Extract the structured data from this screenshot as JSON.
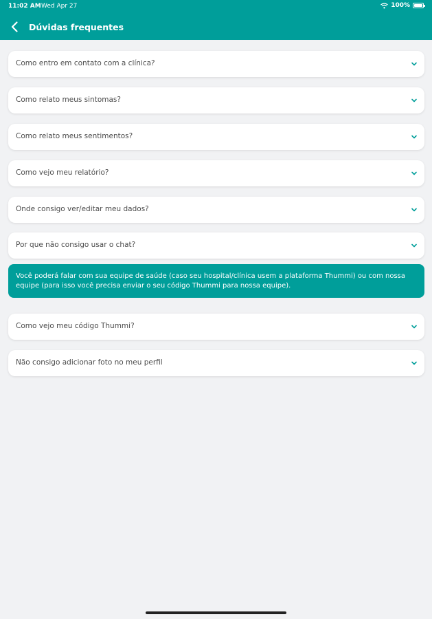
{
  "status": {
    "time": "11:02 AM",
    "date": "Wed Apr 27",
    "battery": "100%",
    "battery_level": 1.0
  },
  "header": {
    "title": "Dúvidas frequentes",
    "back_icon": "chevron-left-icon",
    "color": "#009e9a"
  },
  "faq": {
    "items": [
      {
        "question": "Como entro em contato com a clínica?"
      },
      {
        "question": "Como relato meus sintomas?"
      },
      {
        "question": "Como relato meus sentimentos?"
      },
      {
        "question": "Como vejo meu relatório?"
      },
      {
        "question": "Onde consigo ver/editar meu dados?"
      },
      {
        "question": "Por que não consigo usar o chat?"
      },
      {
        "question": "Como vejo meu código Thummi?"
      },
      {
        "question": "Não consigo adicionar foto no meu perfil"
      }
    ],
    "expanded_answer": "Você poderá falar com sua equipe de saúde (caso seu hospital/clínica usem a plataforma Thummi) ou com nossa equipe (para isso você precisa enviar o seu código Thummi para nossa equipe).",
    "chevron_icon": "chevron-down-icon",
    "accent": "#009e9a"
  }
}
